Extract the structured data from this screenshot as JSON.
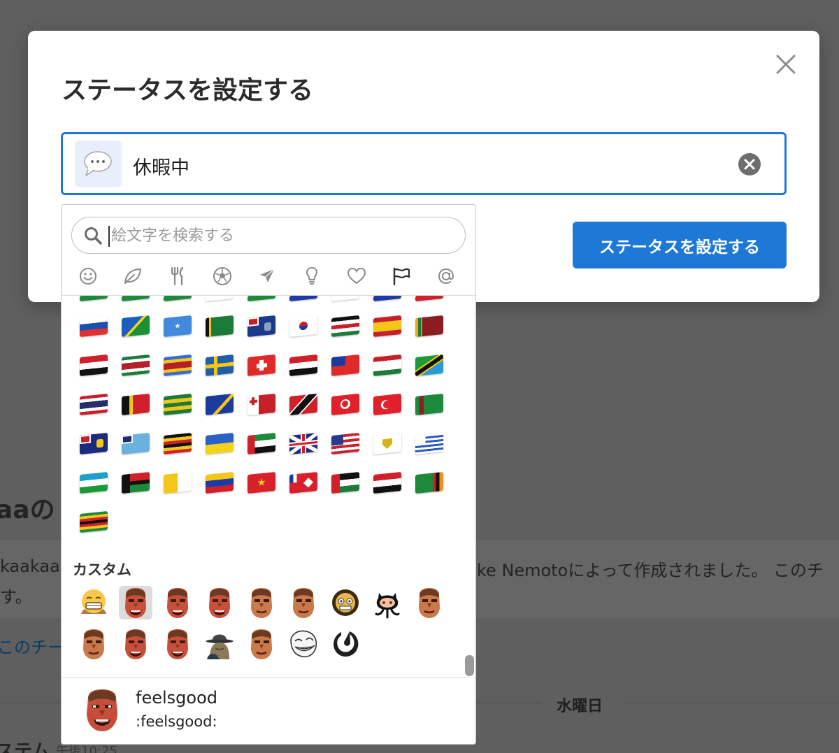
{
  "background": {
    "channel_title": "aaの",
    "desc_line1": "kaakaa",
    "desc_line2": "す。",
    "desc_right": "ke Nemotoによって作成されました。 このチ",
    "link": "このチー",
    "day": "水曜日",
    "system": "ステム",
    "time": "午後10:25"
  },
  "modal": {
    "title": "ステータスを設定する",
    "status_text": "休暇中",
    "submit_label": "ステータスを設定する"
  },
  "picker": {
    "search_placeholder": "絵文字を検索する",
    "categories": [
      "smileys",
      "nature",
      "food",
      "activity",
      "travel",
      "objects",
      "symbols",
      "flags",
      "custom"
    ],
    "custom_section_label": "カスタム",
    "preview": {
      "name": "feelsgood",
      "code": ":feelsgood:"
    }
  },
  "flags": [
    [
      "slovenia",
      "solomon-islands",
      "somalia",
      "south-africa",
      "south-georgia",
      "south-korea",
      "south-sudan",
      "spain",
      "sri-lanka"
    ],
    [
      "sudan",
      "suriname",
      "eswatini",
      "sweden",
      "switzerland",
      "syria",
      "taiwan",
      "tajikistan",
      "tanzania"
    ],
    [
      "thailand",
      "timor-leste",
      "togo",
      "tokelau",
      "tonga",
      "trinidad-tobago",
      "tunisia",
      "turkey",
      "turkmenistan"
    ],
    [
      "turks-caicos",
      "tuvalu",
      "uganda",
      "ukraine",
      "uae",
      "uk",
      "usa",
      "us-virgin-islands",
      "uruguay"
    ],
    [
      "uzbekistan",
      "vanuatu",
      "vatican",
      "venezuela",
      "vietnam",
      "wallis-futuna",
      "western-sahara",
      "yemen",
      "zambia"
    ],
    [
      "zimbabwe"
    ]
  ],
  "custom_emojis": [
    "grimace",
    "feelsgood",
    "rage1",
    "rage2",
    "doomguy1",
    "doomguy2",
    "goberserk",
    "octocat",
    "doomguy3",
    "doomguy4",
    "doomguy5",
    "rage3",
    "spy",
    "doomguy6",
    "troll",
    "mattermost"
  ],
  "selected_custom_emoji": "feelsgood",
  "colors": {
    "accent": "#1d78d6",
    "overlay": "#5f5f5f",
    "focus_border": "#1d78d6"
  }
}
